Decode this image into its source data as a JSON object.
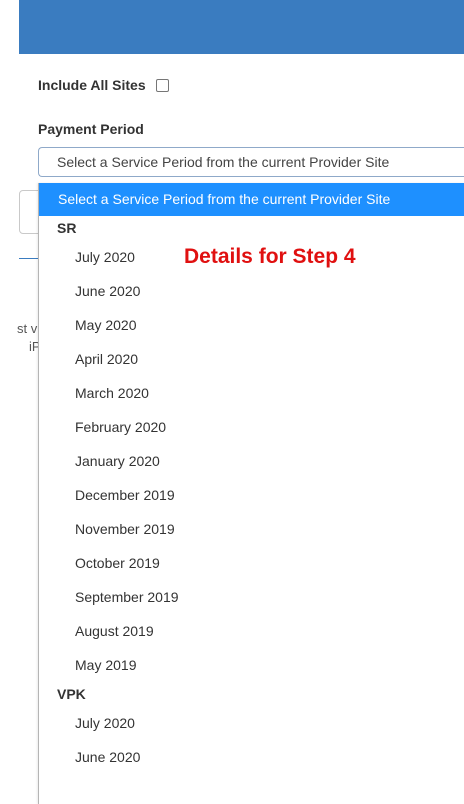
{
  "form": {
    "include_all_sites_label": "Include All Sites",
    "payment_period_label": "Payment Period",
    "select_value": "Select a Service Period from the current Provider Site"
  },
  "dropdown": {
    "selected_option": "Select a Service Period from the current Provider Site",
    "groups": [
      {
        "label": "SR",
        "options": [
          "July 2020",
          "June 2020",
          "May 2020",
          "April 2020",
          "March 2020",
          "February 2020",
          "January 2020",
          "December 2019",
          "November 2019",
          "October 2019",
          "September 2019",
          "August 2019",
          "May 2019"
        ]
      },
      {
        "label": "VPK",
        "options": [
          "July 2020",
          "June 2020"
        ]
      }
    ]
  },
  "annotation": {
    "text": "Details for Step 4",
    "color": "#e01010"
  },
  "background": {
    "partial_text_1": "st v",
    "partial_text_2": "iP"
  },
  "colors": {
    "header": "#3a7cc0",
    "highlight": "#1e90ff"
  }
}
